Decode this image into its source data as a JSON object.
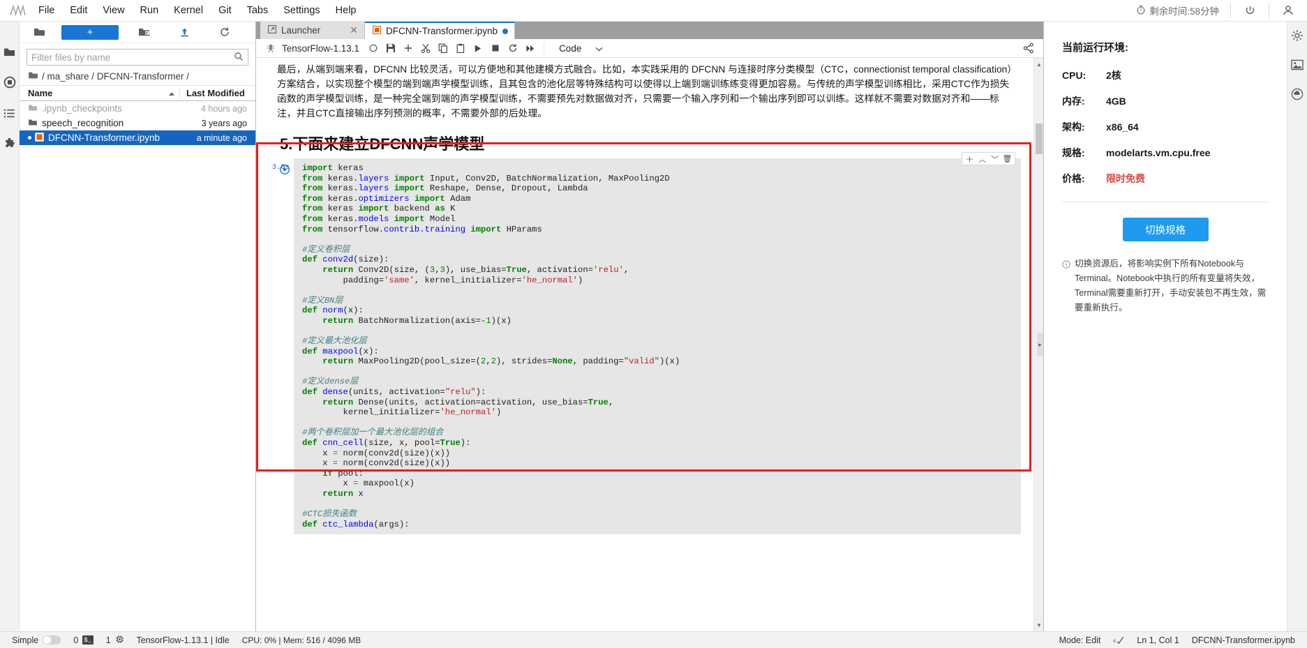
{
  "menubar": {
    "logo_icon": "jupyterlab-logo-icon",
    "items": [
      "File",
      "Edit",
      "View",
      "Run",
      "Kernel",
      "Git",
      "Tabs",
      "Settings",
      "Help"
    ],
    "timer_icon": "stopwatch-icon",
    "timer_text": "剩余时间:58分钟",
    "power_icon": "power-icon",
    "account_icon": "user-account-icon"
  },
  "rail": {
    "items": [
      {
        "name": "sidebar-item-file-browser",
        "icon": "folder-icon"
      },
      {
        "name": "sidebar-item-running",
        "icon": "stop-circle-icon"
      },
      {
        "name": "sidebar-item-commands",
        "icon": "list-icon"
      },
      {
        "name": "sidebar-item-extensions",
        "icon": "puzzle-icon"
      }
    ]
  },
  "filebrowser": {
    "new_label": "+",
    "toolbar_icons": [
      "folder-icon",
      "new-folder-icon",
      "upload-icon",
      "refresh-icon"
    ],
    "filter_placeholder": "Filter files by name",
    "filter_value": "",
    "search_icon": "search-icon",
    "breadcrumb": "/ ma_share / DFCNN-Transformer /",
    "columns": [
      "Name",
      "Last Modified"
    ],
    "sort_icon": "sort-asc-icon",
    "rows": [
      {
        "name": ".ipynb_checkpoints",
        "modified": "4 hours ago",
        "icon": "folder-icon",
        "type": "folder",
        "dim": true,
        "selected": false
      },
      {
        "name": "speech_recognition",
        "modified": "3 years ago",
        "icon": "folder-icon",
        "type": "folder",
        "dim": false,
        "selected": false
      },
      {
        "name": "DFCNN-Transformer.ipynb",
        "modified": "a minute ago",
        "icon": "notebook-icon",
        "type": "notebook",
        "dim": false,
        "selected": true
      }
    ]
  },
  "tabs": [
    {
      "label": "Launcher",
      "icon": "launcher-icon",
      "active": false,
      "dirty": false,
      "close_icon": "close-icon"
    },
    {
      "label": "DFCNN-Transformer.ipynb",
      "icon": "notebook-icon",
      "active": true,
      "dirty": true,
      "close_icon": "close-icon"
    }
  ],
  "notebook_toolbar": {
    "kernel_icon": "kernel-icon",
    "kernel_name": "TensorFlow-1.13.1",
    "kernel_status_icon": "idle-circle-icon",
    "buttons": [
      {
        "name": "save-button",
        "icon": "save-icon"
      },
      {
        "name": "insert-cell-button",
        "icon": "plus-icon"
      },
      {
        "name": "cut-button",
        "icon": "scissors-icon"
      },
      {
        "name": "copy-button",
        "icon": "copy-icon"
      },
      {
        "name": "paste-button",
        "icon": "clipboard-icon"
      },
      {
        "name": "run-button",
        "icon": "play-icon"
      },
      {
        "name": "interrupt-button",
        "icon": "stop-icon"
      },
      {
        "name": "restart-button",
        "icon": "restart-icon"
      },
      {
        "name": "restart-run-all-button",
        "icon": "fast-forward-icon"
      }
    ],
    "celltype_value": "Code",
    "celltype_chevron": "chevron-down-icon",
    "share_icon": "share-icon"
  },
  "notebook": {
    "markdown_paragraph": "最后，从端到端来看，DFCNN 比较灵活，可以方便地和其他建模方式融合。比如，本实践采用的 DFCNN 与连接时序分类模型（CTC，connectionist temporal classification）方案结合，以实现整个模型的端到端声学模型训练，且其包含的池化层等特殊结构可以使得以上端到端训练练变得更加容易。与传统的声学模型训练相比，采用CTC作为损失函数的声学模型训练，是一种完全端到端的声学模型训练，不需要预先对数据做对齐，只需要一个输入序列和一个输出序列即可以训练。这样就不需要对数据对齐和——标注，并且CTC直接输出序列预测的概率，不需要外部的后处理。",
    "section_heading": "5.下面来建立DFCNN声学模型",
    "cell": {
      "prompt": "3.6s",
      "run_icon": "play-circle-icon",
      "toolbar_icons": [
        "duplicate-icon",
        "move-up-icon",
        "move-down-icon",
        "delete-icon"
      ],
      "code_lines": [
        "import keras",
        "from keras.layers import Input, Conv2D, BatchNormalization, MaxPooling2D",
        "from keras.layers import Reshape, Dense, Dropout, Lambda",
        "from keras.optimizers import Adam",
        "from keras import backend as K",
        "from keras.models import Model",
        "from tensorflow.contrib.training import HParams",
        "",
        "#定义卷积层",
        "def conv2d(size):",
        "    return Conv2D(size, (3,3), use_bias=True, activation='relu',",
        "        padding='same', kernel_initializer='he_normal')",
        "",
        "#定义BN层",
        "def norm(x):",
        "    return BatchNormalization(axis=-1)(x)",
        "",
        "#定义最大池化层",
        "def maxpool(x):",
        "    return MaxPooling2D(pool_size=(2,2), strides=None, padding=\"valid\")(x)",
        "",
        "#定义dense层",
        "def dense(units, activation=\"relu\"):",
        "    return Dense(units, activation=activation, use_bias=True,",
        "        kernel_initializer='he_normal')",
        "",
        "#两个卷积层加一个最大池化层的组合",
        "def cnn_cell(size, x, pool=True):",
        "    x = norm(conv2d(size)(x))",
        "    x = norm(conv2d(size)(x))",
        "    if pool:",
        "        x = maxpool(x)",
        "    return x",
        "",
        "#CTC损失函数",
        "def ctc_lambda(args):"
      ]
    }
  },
  "rightpanel": {
    "title": "当前运行环境:",
    "rows": [
      {
        "key": "CPU:",
        "value": "2核",
        "highlight": false
      },
      {
        "key": "内存:",
        "value": "4GB",
        "highlight": false
      },
      {
        "key": "架构:",
        "value": "x86_64",
        "highlight": false
      },
      {
        "key": "规格:",
        "value": "modelarts.vm.cpu.free",
        "highlight": false
      },
      {
        "key": "价格:",
        "value": "限时免费",
        "highlight": true
      }
    ],
    "switch_button": "切换规格",
    "note_icon": "info-icon",
    "note": "切换资源后，将影响实例下所有Notebook与Terminal。Notebook中执行的所有变量将失效，Terminal需要重新打开，手动安装包不再生效，需要重新执行。"
  },
  "rightrail": {
    "items": [
      {
        "name": "sidebar-item-property-inspector",
        "icon": "gear-icon"
      },
      {
        "name": "sidebar-item-image-viewer",
        "icon": "image-icon"
      },
      {
        "name": "sidebar-item-modelarts",
        "icon": "cloud-icon"
      }
    ]
  },
  "statusbar": {
    "simple_label": "Simple",
    "simple_toggle_on": false,
    "terminals_count": "0",
    "terminal_icon": "terminal-icon",
    "kernels_count": "1",
    "kernel_icon": "kernel-chip-icon",
    "kernel_status": "TensorFlow-1.13.1 | Idle",
    "resources": "CPU: 0% | Mem: 516 / 4096 MB",
    "mode": "Mode: Edit",
    "spellcheck_icon": "spellcheck-icon",
    "position": "Ln 1, Col 1",
    "filename": "DFCNN-Transformer.ipynb"
  },
  "colors": {
    "accent": "#1976d2",
    "button_blue": "#1e9bee",
    "red_highlight": "#ee1c1c",
    "free_red": "#e0483e"
  }
}
